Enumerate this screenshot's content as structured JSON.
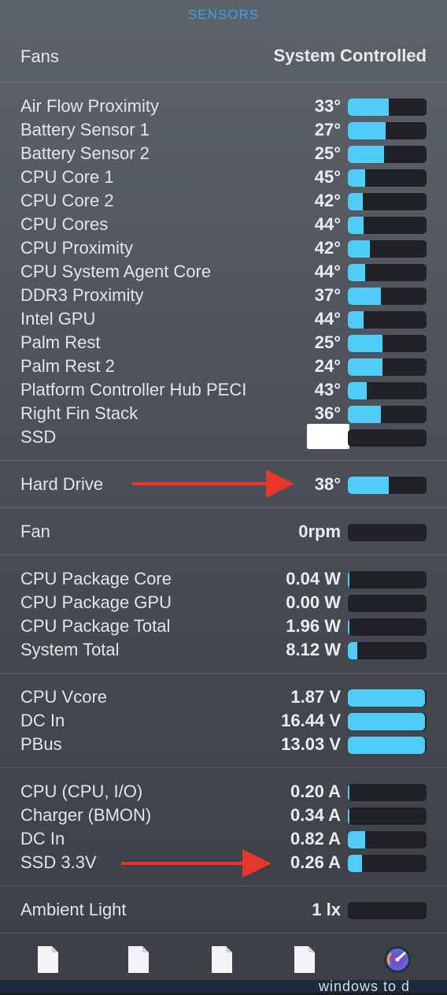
{
  "header": {
    "title": "SENSORS"
  },
  "fans_mode": {
    "label": "Fans",
    "value": "System Controlled"
  },
  "temperatures": [
    {
      "label": "Air Flow Proximity",
      "value": "33°",
      "level": 0.52
    },
    {
      "label": "Battery Sensor 1",
      "value": "27°",
      "level": 0.48
    },
    {
      "label": "Battery Sensor 2",
      "value": "25°",
      "level": 0.46
    },
    {
      "label": "CPU Core 1",
      "value": "45°",
      "level": 0.22
    },
    {
      "label": "CPU Core 2",
      "value": "42°",
      "level": 0.19
    },
    {
      "label": "CPU Cores",
      "value": "44°",
      "level": 0.2
    },
    {
      "label": "CPU Proximity",
      "value": "42°",
      "level": 0.28
    },
    {
      "label": "CPU System Agent Core",
      "value": "44°",
      "level": 0.22
    },
    {
      "label": "DDR3 Proximity",
      "value": "37°",
      "level": 0.42
    },
    {
      "label": "Intel GPU",
      "value": "44°",
      "level": 0.2
    },
    {
      "label": "Palm Rest",
      "value": "25°",
      "level": 0.44
    },
    {
      "label": "Palm Rest 2",
      "value": "24°",
      "level": 0.44
    },
    {
      "label": "Platform Controller Hub PECI",
      "value": "43°",
      "level": 0.24
    },
    {
      "label": "Right Fin Stack",
      "value": "36°",
      "level": 0.42
    },
    {
      "label": "SSD",
      "value": "",
      "level": 0,
      "redacted": true
    }
  ],
  "hard_drive": {
    "label": "Hard Drive",
    "value": "38°",
    "level": 0.52
  },
  "fan": {
    "label": "Fan",
    "value": "0rpm",
    "level": 0
  },
  "power": [
    {
      "label": "CPU Package Core",
      "value": "0.04 W",
      "level": 0.02
    },
    {
      "label": "CPU Package GPU",
      "value": "0.00 W",
      "level": 0.0
    },
    {
      "label": "CPU Package Total",
      "value": "1.96 W",
      "level": 0.02
    },
    {
      "label": "System Total",
      "value": "8.12 W",
      "level": 0.12
    }
  ],
  "voltage": [
    {
      "label": "CPU Vcore",
      "value": "1.87 V",
      "level": 0.98
    },
    {
      "label": "DC In",
      "value": "16.44 V",
      "level": 0.98
    },
    {
      "label": "PBus",
      "value": "13.03 V",
      "level": 0.98
    }
  ],
  "current": [
    {
      "label": "CPU (CPU, I/O)",
      "value": "0.20 A",
      "level": 0.02
    },
    {
      "label": "Charger (BMON)",
      "value": "0.34 A",
      "level": 0.02
    },
    {
      "label": "DC In",
      "value": "0.82 A",
      "level": 0.22
    },
    {
      "label": "SSD 3.3V",
      "value": "0.26 A",
      "level": 0.18
    }
  ],
  "ambient": {
    "label": "Ambient Light",
    "value": "1 lx",
    "level": 0
  },
  "footer": {
    "icons": [
      "document-icon",
      "document-icon",
      "document-icon",
      "document-icon",
      "activity-monitor-icon"
    ]
  },
  "background_text": "windows to d",
  "colors": {
    "accent": "#3f9ee9",
    "bar_fill": "#4fcdf8",
    "bar_track": "#202227",
    "arrow": "#e8362b"
  }
}
